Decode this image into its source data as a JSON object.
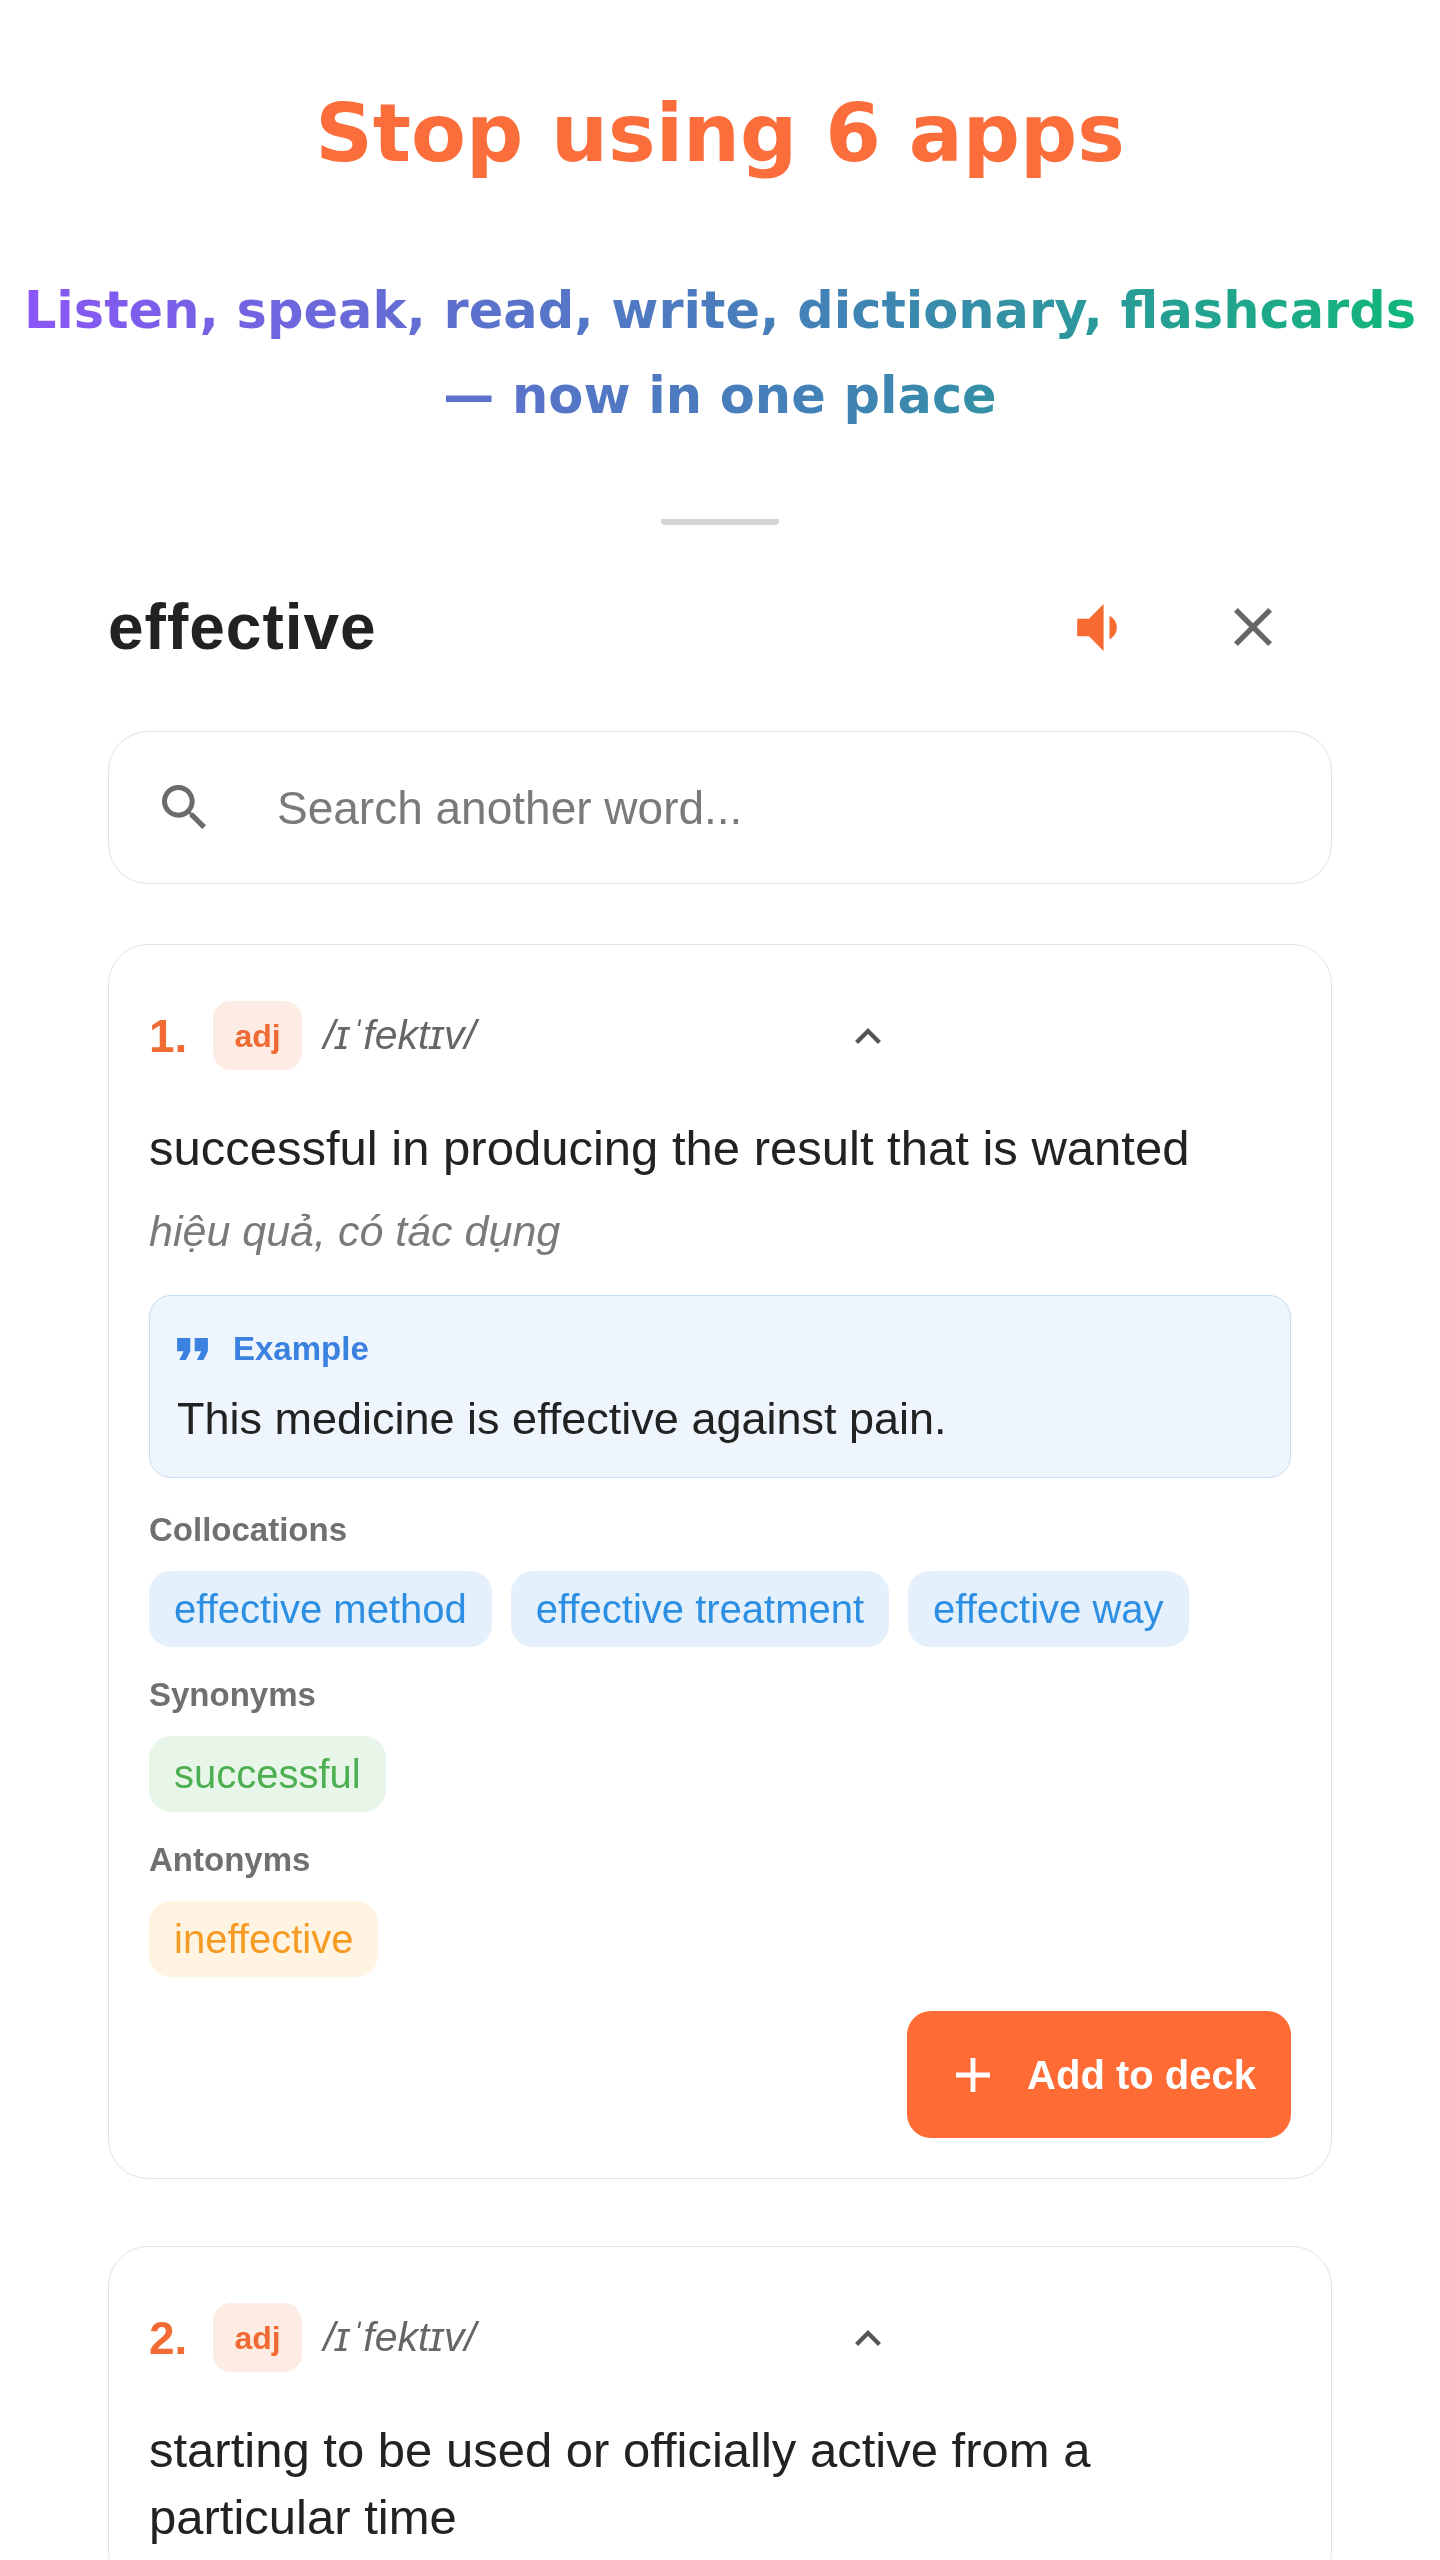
{
  "headline": {
    "title": "Stop using 6 apps",
    "subtitle": "Listen, speak, read, write, dictionary, flashcards — now in one place"
  },
  "sheet": {
    "word": "effective",
    "search": {
      "placeholder": "Search another word..."
    },
    "senses": [
      {
        "number": "1.",
        "part_of_speech": "adj",
        "phonetic": "/ɪˈfektɪv/",
        "expanded": true,
        "definition": "successful in producing the result that is wanted",
        "translation": "hiệu quả, có tác dụng",
        "example": {
          "label": "Example",
          "text": "This medicine is effective against pain."
        },
        "groups": [
          {
            "kind": "collocations",
            "label": "Collocations",
            "items": [
              "effective method",
              "effective treatment",
              "effective way"
            ]
          },
          {
            "kind": "synonyms",
            "label": "Synonyms",
            "items": [
              "successful"
            ]
          },
          {
            "kind": "antonyms",
            "label": "Antonyms",
            "items": [
              "ineffective"
            ]
          }
        ],
        "action": "Add to deck"
      },
      {
        "number": "2.",
        "part_of_speech": "adj",
        "phonetic": "/ɪˈfektɪv/",
        "expanded": true,
        "definition": "starting to be used or officially active from a particular time"
      }
    ]
  }
}
